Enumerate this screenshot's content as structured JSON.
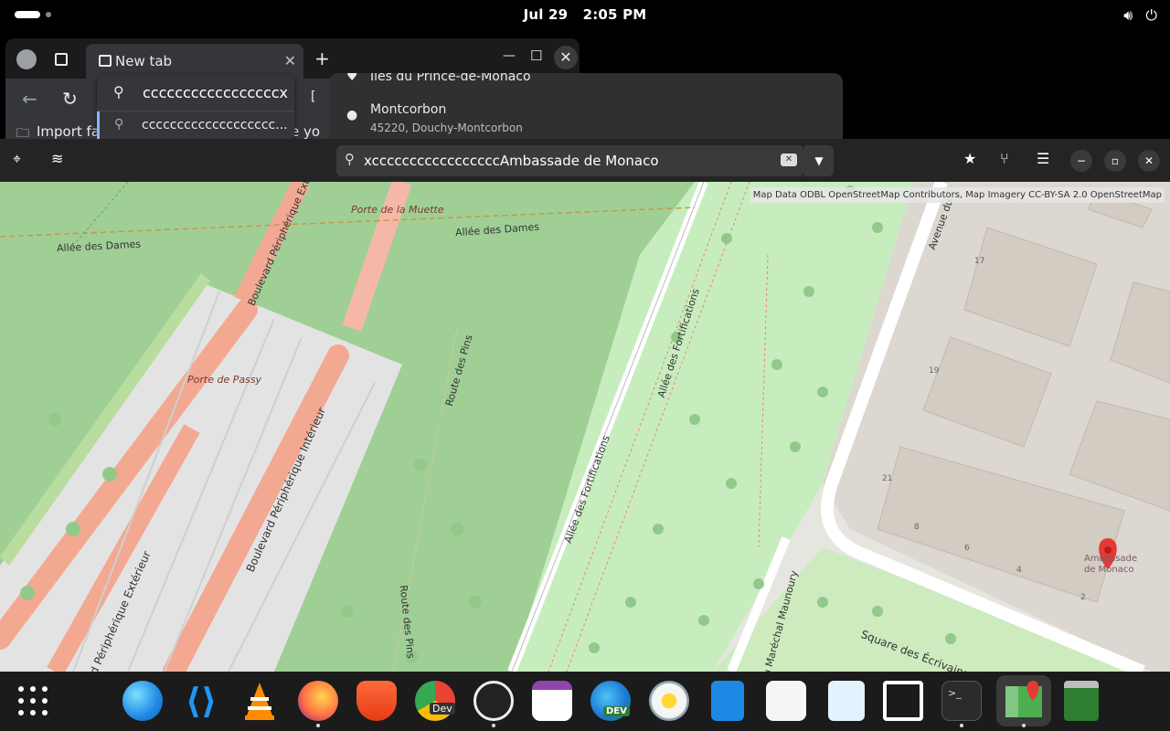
{
  "topbar": {
    "date": "Jul 29",
    "time": "2:05 PM",
    "volume_icon": "volume-icon",
    "power_icon": "power-icon"
  },
  "browser": {
    "tab_title": "New tab",
    "omnibox_text": "cccccccccccccccccx",
    "suggestion_text": "ccccccccccccccccccc...",
    "bookmarks_label": "Import fav",
    "partial_text": "e yo"
  },
  "popup": {
    "items": [
      {
        "name": "Îles du Prince-de-Monaco",
        "address": ""
      },
      {
        "name": "Montcorbon",
        "address": "45220, Douchy-Montcorbon"
      }
    ]
  },
  "maps": {
    "search_value": "xcccccccccccccccccAmbassade de Monaco",
    "attribution": "Map Data ODBL OpenStreetMap Contributors, Map Imagery CC-BY-SA 2.0 OpenStreetMap",
    "labels": {
      "allee_dames_1": "Allée des Dames",
      "allee_dames_2": "Allée des Dames",
      "porte_muette": "Porte de la Muette",
      "porte_passy": "Porte de Passy",
      "bd_peri_ext_top": "Boulevard Périphérique Ext",
      "bd_peri_int": "Boulevard Périphérique Intérieur",
      "bd_peri_ext_bottom": "ard Périphérique Extérieur",
      "route_pins_1": "Route des Pins",
      "route_pins_2": "Route des Pins",
      "allee_fortif_1": "Allée des Fortifications",
      "allee_fortif_2": "Allée des Fortifications",
      "avenue": "Avenue du ",
      "maunoury": "du Maréchal Maunoury",
      "square": "Square des Écrivains Combattants Morts pour la France",
      "num_17": "17",
      "num_19": "19",
      "num_21": "21",
      "num_8": "8",
      "num_6": "6",
      "num_4": "4",
      "num_2": "2",
      "ambassade_1": "Ambassade",
      "ambassade_2": "de Monaco"
    }
  },
  "dock": {
    "apps": [
      "apps-grid",
      "globe",
      "vscode",
      "vlc",
      "firefox",
      "brave",
      "chrome-dev",
      "obs",
      "calendar",
      "edge-dev",
      "rhythmbox",
      "files",
      "software",
      "text-editor",
      "inkscape",
      "terminal",
      "maps",
      "trash"
    ],
    "chrome_dev_badge": "Dev",
    "edge_dev_badge": "DEV"
  },
  "colors": {
    "accent": "#e53935",
    "park": "#aad8a0",
    "road": "#f4a48c"
  }
}
